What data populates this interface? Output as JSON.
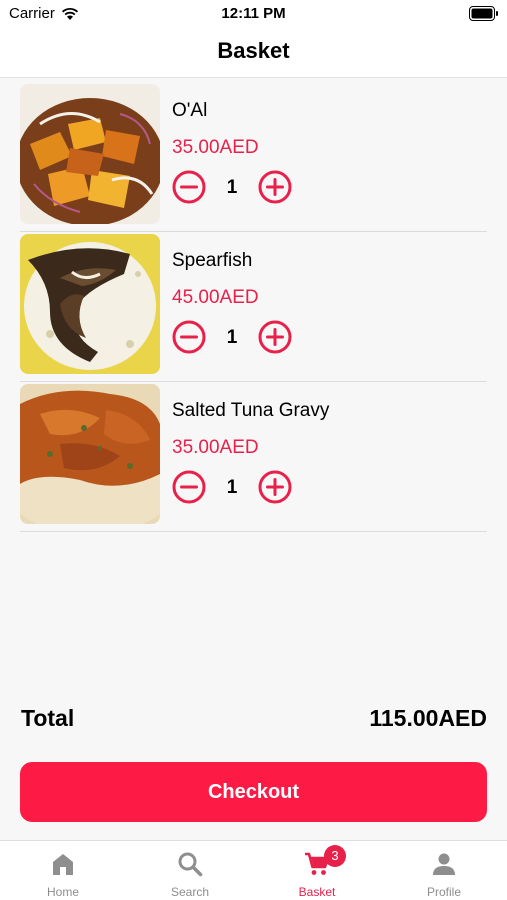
{
  "status_bar": {
    "carrier": "Carrier",
    "time": "12:11 PM"
  },
  "header": {
    "title": "Basket"
  },
  "basket": {
    "items": [
      {
        "name": "O'Al",
        "price": "35.00AED",
        "quantity": "1"
      },
      {
        "name": "Spearfish",
        "price": "45.00AED",
        "quantity": "1"
      },
      {
        "name": "Salted Tuna Gravy",
        "price": "35.00AED",
        "quantity": "1"
      }
    ]
  },
  "summary": {
    "total_label": "Total",
    "total_value": "115.00AED"
  },
  "checkout": {
    "label": "Checkout"
  },
  "tab_bar": {
    "tabs": [
      {
        "label": "Home",
        "icon": "home-icon"
      },
      {
        "label": "Search",
        "icon": "search-icon"
      },
      {
        "label": "Basket",
        "icon": "cart-icon",
        "badge": "3",
        "active": true
      },
      {
        "label": "Profile",
        "icon": "person-icon"
      }
    ]
  },
  "colors": {
    "accent": "#fd1a45",
    "price": "#e8214b",
    "inactive_tab": "#8e8e8e"
  }
}
